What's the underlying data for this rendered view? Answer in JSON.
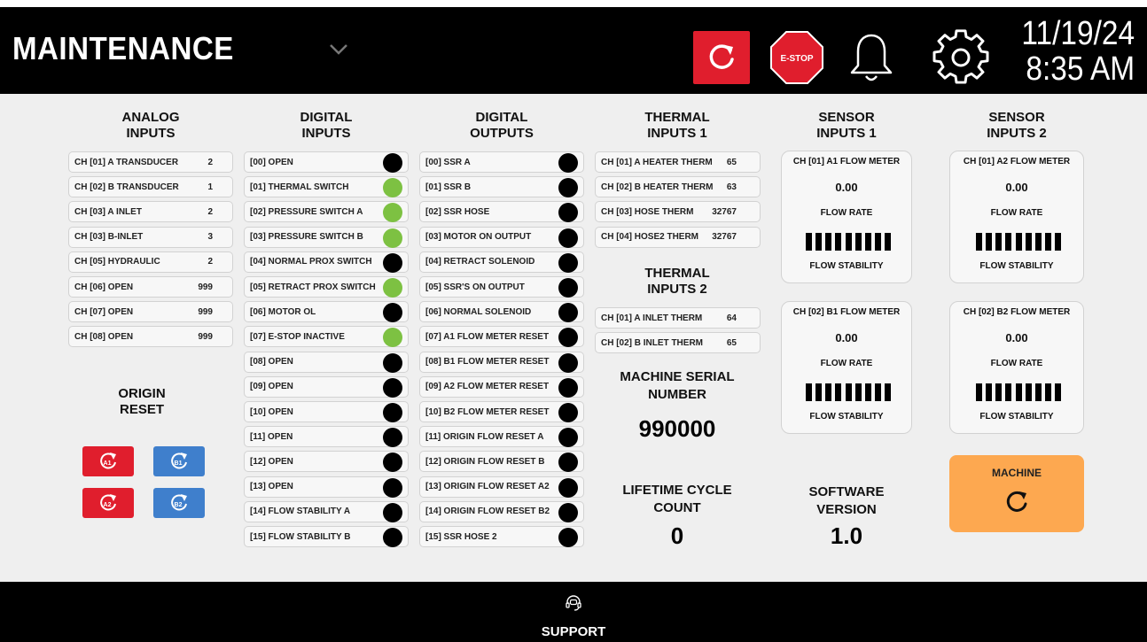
{
  "header": {
    "title": "MAINTENANCE",
    "date": "11/19/24",
    "time": "8:35 AM",
    "estop_label": "E-STOP",
    "icons": [
      "chevron-down-icon",
      "refresh-icon",
      "estop-icon",
      "bell-icon",
      "gear-icon"
    ],
    "colors": {
      "refresh": "#e01e2d",
      "estop": "#e01e2d"
    }
  },
  "analog": {
    "title1": "ANALOG",
    "title2": "INPUTS",
    "rows": [
      {
        "label": "CH [01] A TRANSDUCER",
        "value": "2"
      },
      {
        "label": "CH [02] B TRANSDUCER",
        "value": "1"
      },
      {
        "label": "CH [03] A INLET",
        "value": "2"
      },
      {
        "label": "CH [03] B-INLET",
        "value": "3"
      },
      {
        "label": "CH [05] HYDRAULIC",
        "value": "2"
      },
      {
        "label": "CH [06] OPEN",
        "value": "999"
      },
      {
        "label": "CH [07] OPEN",
        "value": "999"
      },
      {
        "label": "CH [08] OPEN",
        "value": "999"
      }
    ]
  },
  "origin": {
    "title1": "ORIGIN",
    "title2": "RESET",
    "buttons": [
      {
        "label": "A1",
        "color": "#e01e2d"
      },
      {
        "label": "B1",
        "color": "#3f7fcc"
      },
      {
        "label": "A2",
        "color": "#e01e2d"
      },
      {
        "label": "B2",
        "color": "#3f7fcc"
      }
    ]
  },
  "digital_inputs": {
    "title1": "DIGITAL",
    "title2": "INPUTS",
    "rows": [
      {
        "label": "[00] OPEN",
        "on": false
      },
      {
        "label": "[01] THERMAL SWITCH",
        "on": true
      },
      {
        "label": "[02] PRESSURE SWITCH A",
        "on": true
      },
      {
        "label": "[03] PRESSURE SWITCH B",
        "on": true
      },
      {
        "label": "[04] NORMAL PROX SWITCH",
        "on": false
      },
      {
        "label": "[05] RETRACT PROX SWITCH",
        "on": true
      },
      {
        "label": "[06] MOTOR OL",
        "on": false
      },
      {
        "label": "[07] E-STOP  INACTIVE",
        "on": true
      },
      {
        "label": "[08] OPEN",
        "on": false
      },
      {
        "label": "[09] OPEN",
        "on": false
      },
      {
        "label": "[10] OPEN",
        "on": false
      },
      {
        "label": "[11] OPEN",
        "on": false
      },
      {
        "label": "[12] OPEN",
        "on": false
      },
      {
        "label": "[13] OPEN",
        "on": false
      },
      {
        "label": "[14] FLOW STABILITY A",
        "on": false
      },
      {
        "label": "[15] FLOW STABILITY B",
        "on": false
      }
    ]
  },
  "digital_outputs": {
    "title1": "DIGITAL",
    "title2": "OUTPUTS",
    "rows": [
      {
        "label": "[00] SSR A",
        "on": false
      },
      {
        "label": "[01] SSR B",
        "on": false
      },
      {
        "label": "[02] SSR HOSE",
        "on": false
      },
      {
        "label": "[03] MOTOR ON OUTPUT",
        "on": false
      },
      {
        "label": "[04] RETRACT SOLENOID",
        "on": false
      },
      {
        "label": "[05] SSR'S ON OUTPUT",
        "on": false
      },
      {
        "label": "[06] NORMAL SOLENOID",
        "on": false
      },
      {
        "label": "[07] A1 FLOW METER RESET",
        "on": false
      },
      {
        "label": "[08] B1 FLOW METER RESET",
        "on": false
      },
      {
        "label": "[09] A2 FLOW METER RESET",
        "on": false
      },
      {
        "label": "[10] B2 FLOW METER RESET",
        "on": false
      },
      {
        "label": "[11] ORIGIN FLOW RESET A",
        "on": false
      },
      {
        "label": "[12] ORIGIN FLOW RESET B",
        "on": false
      },
      {
        "label": "[13] ORIGIN FLOW RESET A2",
        "on": false
      },
      {
        "label": "[14] ORIGIN FLOW RESET B2",
        "on": false
      },
      {
        "label": "[15] SSR HOSE 2",
        "on": false
      }
    ]
  },
  "thermal1": {
    "title1": "THERMAL",
    "title2": "INPUTS 1",
    "rows": [
      {
        "label": "CH [01] A HEATER THERM",
        "value": "65"
      },
      {
        "label": "CH [02] B HEATER THERM",
        "value": "63"
      },
      {
        "label": "CH [03] HOSE THERM",
        "value": "32767"
      },
      {
        "label": "CH [04] HOSE2 THERM",
        "value": "32767"
      }
    ]
  },
  "thermal2": {
    "title1": "THERMAL",
    "title2": "INPUTS 2",
    "rows": [
      {
        "label": "CH [01] A INLET THERM",
        "value": "64"
      },
      {
        "label": "CH [02] B INLET THERM",
        "value": "65"
      }
    ]
  },
  "serial": {
    "label1": "MACHINE SERIAL",
    "label2": "NUMBER",
    "value": "990000"
  },
  "lifetime": {
    "label1": "LIFETIME CYCLE",
    "label2": "COUNT",
    "value": "0"
  },
  "software": {
    "label1": "SOFTWARE",
    "label2": "VERSION",
    "value": "1.0"
  },
  "sensor1": {
    "title1": "SENSOR",
    "title2": "INPUTS 1",
    "a": {
      "name": "CH [01] A1 FLOW METER",
      "value": "0.00",
      "rate_label": "FLOW RATE",
      "stability_label": "FLOW STABILITY",
      "stability_bars": 9
    },
    "b": {
      "name": "CH [02] B1 FLOW METER",
      "value": "0.00",
      "rate_label": "FLOW RATE",
      "stability_label": "FLOW STABILITY",
      "stability_bars": 9
    }
  },
  "sensor2": {
    "title1": "SENSOR",
    "title2": "INPUTS 2",
    "a": {
      "name": "CH [01] A2 FLOW METER",
      "value": "0.00",
      "rate_label": "FLOW RATE",
      "stability_label": "FLOW STABILITY",
      "stability_bars": 9
    },
    "b": {
      "name": "CH [02] B2 FLOW METER",
      "value": "0.00",
      "rate_label": "FLOW RATE",
      "stability_label": "FLOW STABILITY",
      "stability_bars": 9
    }
  },
  "machine": {
    "label": "MACHINE",
    "color": "#fda850"
  },
  "footer": {
    "support_label": "SUPPORT"
  },
  "colors": {
    "on": "#7dc142",
    "off": "#000000"
  }
}
